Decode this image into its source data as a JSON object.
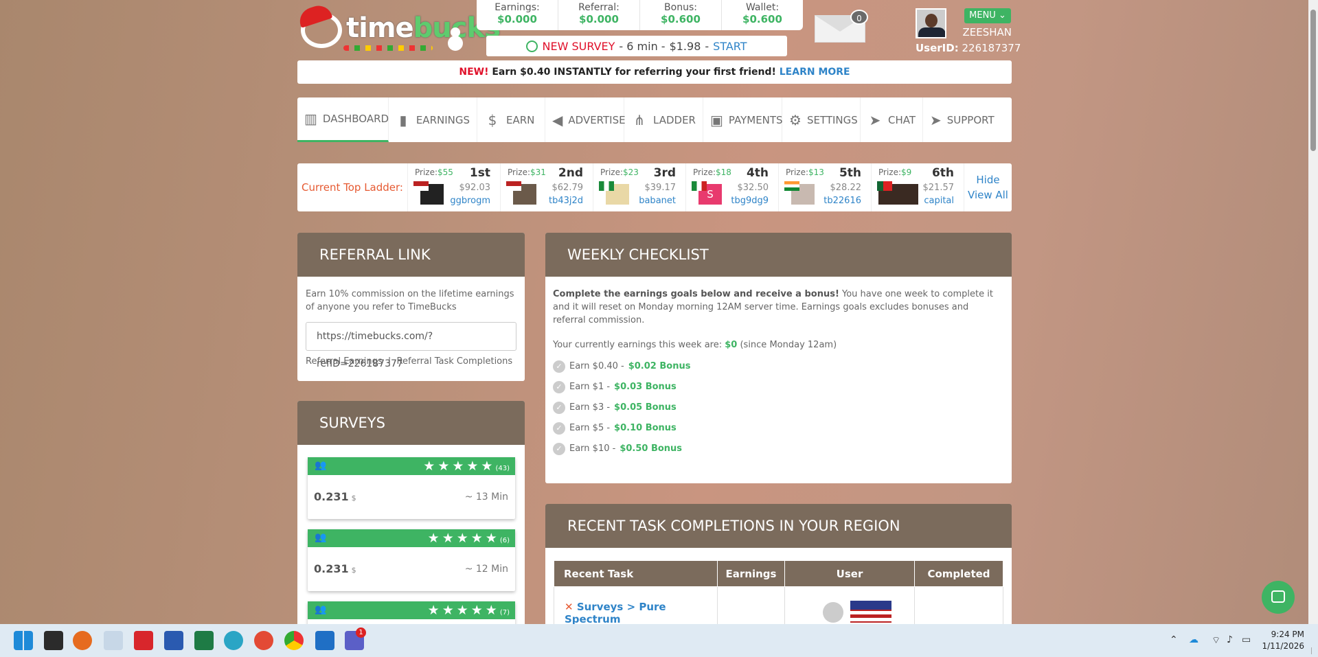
{
  "logo": {
    "text_a": "time",
    "text_b": "bucks"
  },
  "balances": [
    {
      "label": "Earnings:",
      "value": "$0.000"
    },
    {
      "label": "Referral:",
      "value": "$0.000"
    },
    {
      "label": "Bonus:",
      "value": "$0.600"
    },
    {
      "label": "Wallet:",
      "value": "$0.600"
    }
  ],
  "survey_bar": {
    "label": "NEW SURVEY",
    "duration": "- 6 min -",
    "amount": "$1.98",
    "sep": "-",
    "action": "START"
  },
  "mail": {
    "count": "0"
  },
  "user": {
    "menu": "MENU",
    "name": "ZEESHAN",
    "id_label": "UserID:",
    "id_value": "226187377"
  },
  "notice": {
    "new": "NEW!",
    "text": "Earn $0.40 INSTANTLY for referring your first friend!",
    "link": "LEARN MORE"
  },
  "nav": [
    {
      "label": "DASHBOARD",
      "icon": "dashboard-icon",
      "glyph": "▥"
    },
    {
      "label": "EARNINGS",
      "icon": "earnings-icon",
      "glyph": "▮"
    },
    {
      "label": "EARN",
      "icon": "earn-icon",
      "glyph": "$"
    },
    {
      "label": "ADVERTISE",
      "icon": "megaphone-icon",
      "glyph": "◀"
    },
    {
      "label": "LADDER",
      "icon": "ladder-icon",
      "glyph": "⋔"
    },
    {
      "label": "PAYMENTS",
      "icon": "wallet-icon",
      "glyph": "▣"
    },
    {
      "label": "SETTINGS",
      "icon": "gear-icon",
      "glyph": "⚙"
    },
    {
      "label": "CHAT",
      "icon": "chat-icon",
      "glyph": "➤"
    },
    {
      "label": "SUPPORT",
      "icon": "support-icon",
      "glyph": "➤"
    }
  ],
  "ladder": {
    "title": "Current Top Ladder:",
    "prize_label": "Prize:",
    "entries": [
      {
        "prize": "$55",
        "rank": "1st",
        "amount": "$92.03",
        "user": "ggbrogm"
      },
      {
        "prize": "$31",
        "rank": "2nd",
        "amount": "$62.79",
        "user": "tb43j2d"
      },
      {
        "prize": "$23",
        "rank": "3rd",
        "amount": "$39.17",
        "user": "babanet"
      },
      {
        "prize": "$18",
        "rank": "4th",
        "amount": "$32.50",
        "user": "tbg9dg9"
      },
      {
        "prize": "$13",
        "rank": "5th",
        "amount": "$28.22",
        "user": "tb22616"
      },
      {
        "prize": "$9",
        "rank": "6th",
        "amount": "$21.57",
        "user": "capital"
      }
    ],
    "hide": "Hide",
    "view_all": "View All"
  },
  "referral": {
    "title": "REFERRAL LINK",
    "desc": "Earn 10% commission on the lifetime earnings of anyone you refer to TimeBucks",
    "link": "https://timebucks.com/?refID=226187377",
    "earnings_link": "Referral Earnings",
    "sep": "|",
    "tasks_link": "Referral Task Completions"
  },
  "surveys": {
    "title": "SURVEYS",
    "items": [
      {
        "stars": "★★★★★",
        "count": "(43)",
        "amount": "0.231",
        "currency": "$",
        "duration": "~ 13 Min"
      },
      {
        "stars": "★★★★★",
        "count": "(6)",
        "amount": "0.231",
        "currency": "$",
        "duration": "~ 12 Min"
      },
      {
        "stars": "★★★★★",
        "count": "(7)",
        "amount": "",
        "currency": "",
        "duration": ""
      }
    ]
  },
  "weekly": {
    "title": "WEEKLY CHECKLIST",
    "intro_bold": "Complete the earnings goals below and receive a bonus!",
    "intro_rest": "You have one week to complete it and it will reset on Monday morning 12AM server time. Earnings goals excludes bonuses and referral commission.",
    "current_pre": "Your currently earnings this week are:",
    "current_val": "$0",
    "current_post": "(since Monday 12am)",
    "goals": [
      {
        "earn": "Earn $0.40 -",
        "bonus": "$0.02 Bonus"
      },
      {
        "earn": "Earn $1 -",
        "bonus": "$0.03 Bonus"
      },
      {
        "earn": "Earn $3 -",
        "bonus": "$0.05 Bonus"
      },
      {
        "earn": "Earn $5 -",
        "bonus": "$0.10 Bonus"
      },
      {
        "earn": "Earn $10 -",
        "bonus": "$0.50 Bonus"
      }
    ]
  },
  "recent": {
    "title": "RECENT TASK COMPLETIONS IN YOUR REGION",
    "headers": [
      "Recent Task",
      "Earnings",
      "User",
      "Completed"
    ],
    "row": {
      "task": "Surveys > Pure Spectrum"
    }
  },
  "taskbar": {
    "time": "9:24 PM",
    "date": "1/11/2026",
    "teams_badge": "1"
  }
}
